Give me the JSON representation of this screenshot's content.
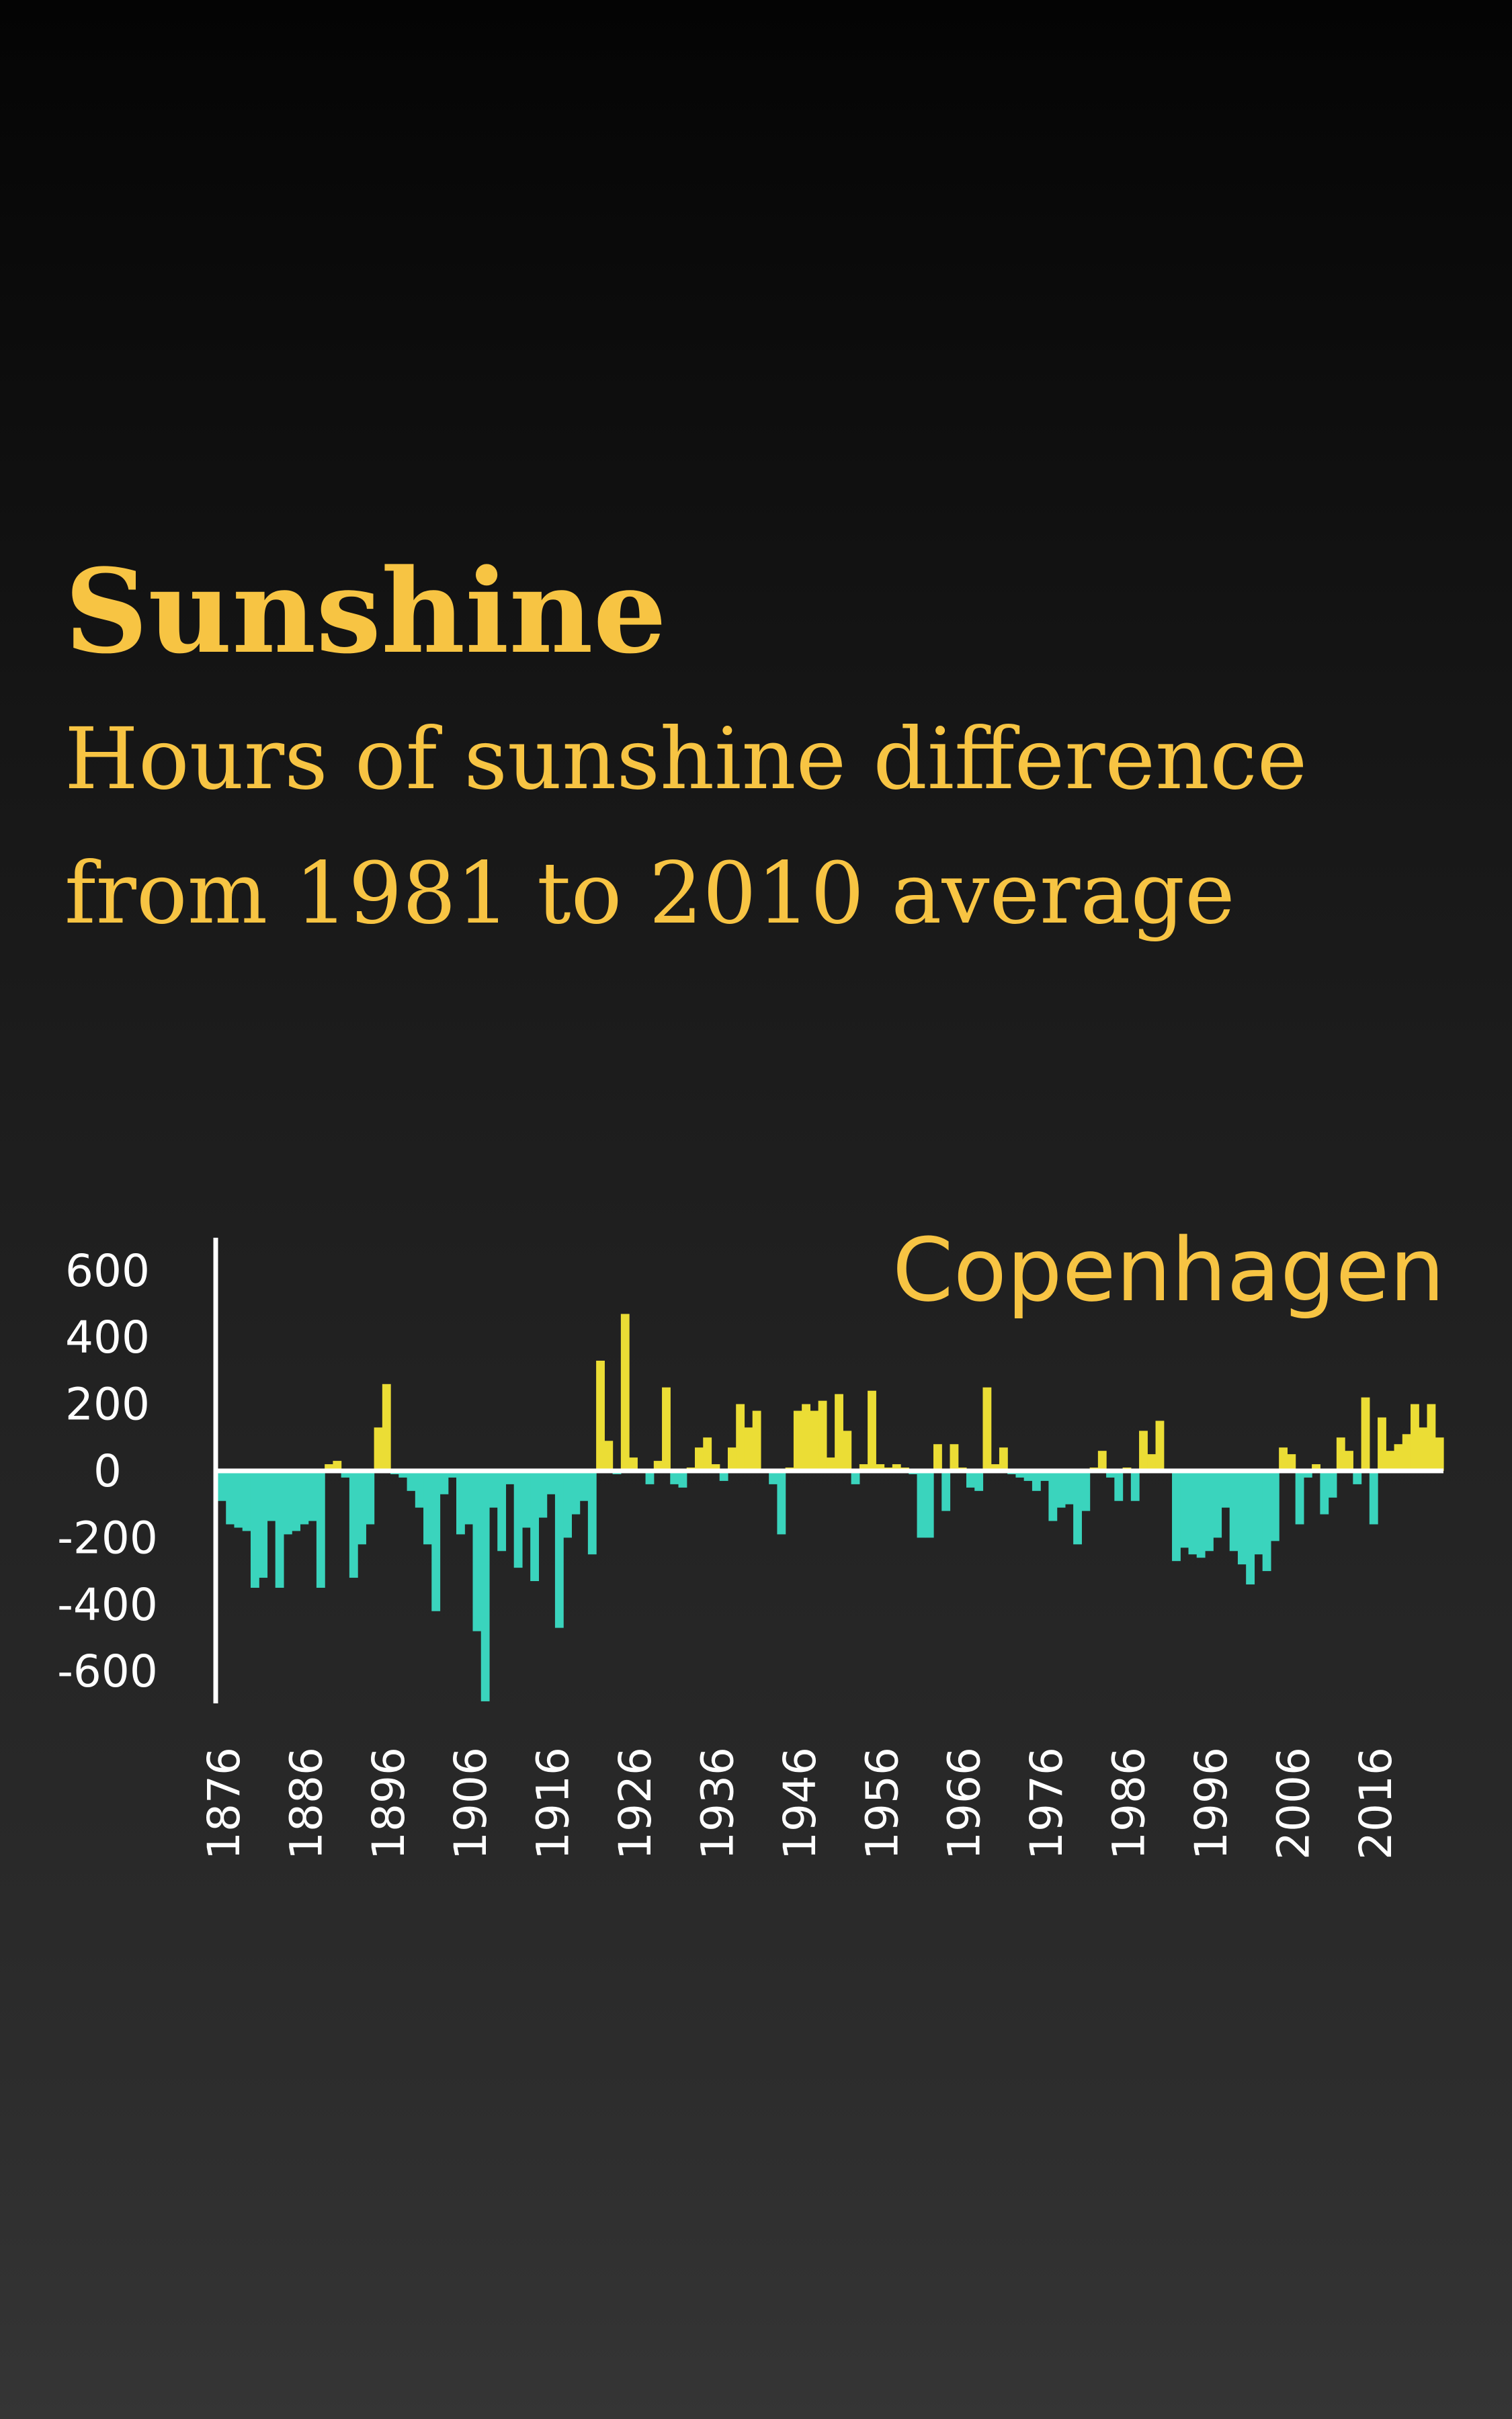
{
  "header": {
    "title": "Sunshine",
    "subtitle": "Hours of sunshine difference from 1981 to 2010 average"
  },
  "colors": {
    "accent": "#f7c443",
    "positive": "#ebdd35",
    "negative": "#3ad4bd",
    "axis": "#ffffff",
    "background_top": "#040404",
    "background_bottom": "#353535"
  },
  "chart_data": {
    "type": "bar",
    "annotation": "Copenhagen",
    "x_start": 1876,
    "x_end": 2019,
    "xticks": [
      1876,
      1886,
      1896,
      1906,
      1916,
      1926,
      1936,
      1946,
      1956,
      1966,
      1976,
      1986,
      1996,
      2006,
      2016
    ],
    "yticks": [
      600,
      400,
      200,
      0,
      -200,
      -400,
      -600
    ],
    "ylim": [
      -700,
      700
    ],
    "grid": false,
    "values": [
      -90,
      -160,
      -170,
      -180,
      -350,
      -320,
      -150,
      -350,
      -190,
      -180,
      -160,
      -150,
      -350,
      20,
      30,
      -20,
      -320,
      -220,
      -160,
      130,
      260,
      -10,
      -20,
      -60,
      -110,
      -220,
      -420,
      -70,
      -20,
      -190,
      -160,
      -480,
      -690,
      -110,
      -240,
      -40,
      -290,
      -170,
      -330,
      -140,
      -70,
      -470,
      -200,
      -130,
      -90,
      -250,
      330,
      90,
      -10,
      470,
      40,
      0,
      -40,
      30,
      250,
      -40,
      -50,
      10,
      70,
      100,
      20,
      -30,
      70,
      200,
      130,
      180,
      0,
      -40,
      -190,
      10,
      180,
      200,
      180,
      210,
      40,
      230,
      120,
      -40,
      20,
      240,
      20,
      10,
      20,
      10,
      -10,
      -200,
      -200,
      80,
      -120,
      80,
      10,
      -50,
      -60,
      250,
      20,
      70,
      -10,
      -20,
      -30,
      -60,
      -30,
      -150,
      -110,
      -100,
      -220,
      -120,
      10,
      60,
      -20,
      -90,
      10,
      -90,
      120,
      50,
      150,
      0,
      -270,
      -230,
      -250,
      -260,
      -240,
      -200,
      -110,
      -240,
      -280,
      -340,
      -250,
      -300,
      -210,
      70,
      50,
      -160,
      -20,
      20,
      -130,
      -80,
      100,
      60,
      -40,
      220,
      -160,
      160,
      60,
      80,
      110,
      200,
      130,
      200,
      100
    ]
  }
}
